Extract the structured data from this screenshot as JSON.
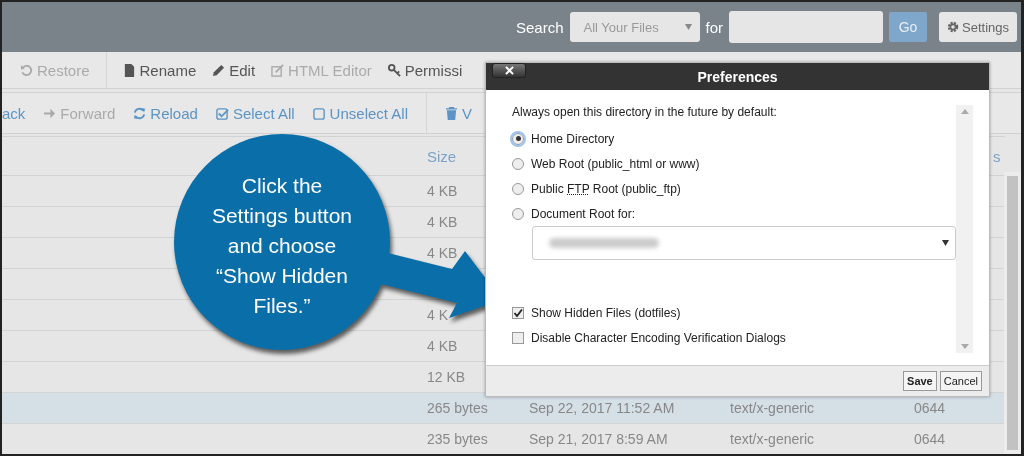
{
  "header": {
    "search_label": "Search",
    "scope": "All Your Files",
    "for_label": "for",
    "go": "Go",
    "settings": "Settings"
  },
  "toolbar_1": [
    {
      "kind": "restore",
      "label": "Restore",
      "disabled": true
    },
    {
      "kind": "file",
      "label": "Rename",
      "disabled": false
    },
    {
      "kind": "pencil",
      "label": "Edit",
      "disabled": false
    },
    {
      "kind": "edit",
      "label": "HTML Editor",
      "disabled": true
    },
    {
      "kind": "key",
      "label": "Permissi",
      "disabled": false
    }
  ],
  "toolbar_2": [
    {
      "kind": "none",
      "label": "ack",
      "disabled": false
    },
    {
      "kind": "arrow",
      "label": "Forward",
      "disabled": true
    },
    {
      "kind": "reload",
      "label": "Reload",
      "disabled": false
    },
    {
      "kind": "checkbox",
      "label": "Select All",
      "disabled": false
    },
    {
      "kind": "square",
      "label": "Unselect All",
      "disabled": false
    },
    {
      "kind": "trash",
      "label": "V",
      "disabled": false
    }
  ],
  "table": {
    "headings": {
      "size": "Size",
      "column_6": "s"
    },
    "rows": [
      {
        "size": "4 KB",
        "selected": false
      },
      {
        "size": "4 KB",
        "selected": false
      },
      {
        "size": "4 KB",
        "selected": false
      },
      {
        "selected": false
      },
      {
        "size": "4 K",
        "selected": false
      },
      {
        "size": "4 KB",
        "selected": false
      },
      {
        "size": "12 KB",
        "selected": false
      },
      {
        "size": "265 bytes",
        "date": "Sep 22, 2017 11:52 AM",
        "type": "text/x-generic",
        "perms": "0644",
        "selected": true
      },
      {
        "size": "235 bytes",
        "date": "Sep 21, 2017 8:59 AM",
        "type": "text/x-generic",
        "perms": "0644",
        "selected": false
      }
    ]
  },
  "dialog": {
    "title": "Preferences",
    "prompt": "Always open this directory in the future by default:",
    "radios": [
      {
        "parts": [
          "Home Directory"
        ],
        "selected": true
      },
      {
        "parts": [
          "Web Root (public_html or www)"
        ],
        "selected": false
      },
      {
        "parts": [
          "Public ",
          "FTP",
          " Root (public_ftp)"
        ],
        "selected": false
      },
      {
        "parts": [
          "Document Root for:"
        ],
        "selected": false
      }
    ],
    "checkboxes": [
      {
        "label": "Show Hidden Files (dotfiles)",
        "checked": true
      },
      {
        "label": "Disable Character Encoding Verification Dialogs",
        "checked": false
      }
    ],
    "buttons": [
      "Save",
      "Cancel"
    ]
  },
  "callout": {
    "lines": [
      "Click the",
      "Settings button",
      "and choose",
      "“Show Hidden",
      "Files.”"
    ]
  }
}
